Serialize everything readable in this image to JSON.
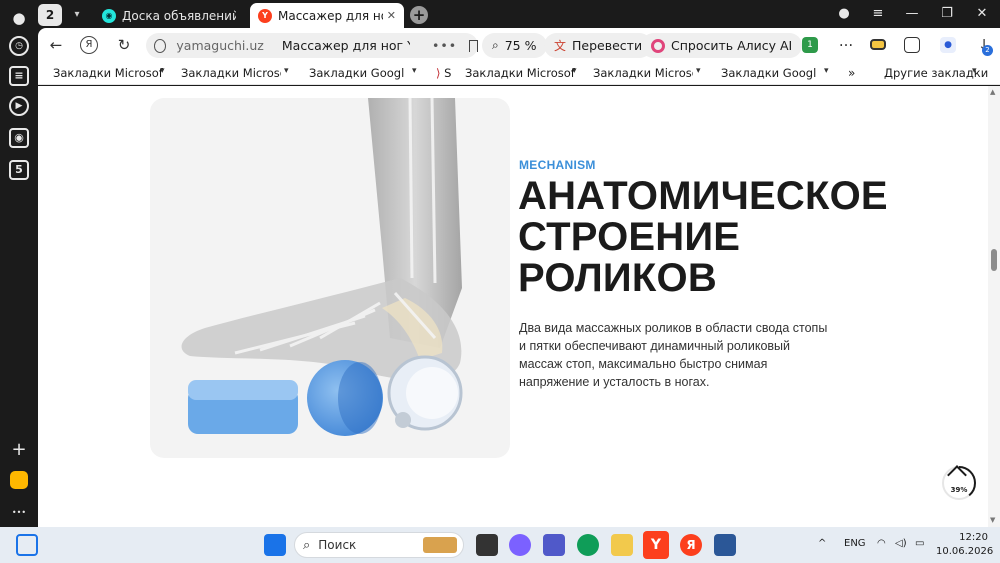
{
  "sidebar": {
    "items": [
      {
        "icon": "user-icon"
      },
      {
        "icon": "history-icon"
      },
      {
        "icon": "collections-icon"
      },
      {
        "icon": "video-icon"
      },
      {
        "icon": "screenshot-icon"
      },
      {
        "icon": "number-5-icon",
        "label": "5"
      },
      {
        "icon": "add-icon",
        "label": "+"
      },
      {
        "icon": "messenger-icon"
      },
      {
        "icon": "more-icon",
        "label": "•••"
      }
    ]
  },
  "tabs": {
    "count_badge": "2",
    "items": [
      {
        "label": "Доска объявлений OLX.uz",
        "favicon": "olx",
        "active": false
      },
      {
        "label": "Массажер для ног Yamaguchi",
        "favicon": "Y",
        "active": true
      }
    ],
    "close_glyph": "✕",
    "new_tab_glyph": "+"
  },
  "window": {
    "profile_glyph": "👤",
    "menu_glyph": "≡",
    "minimize_glyph": "—",
    "restore_glyph": "❐",
    "close_glyph": "✕"
  },
  "toolbar": {
    "back_glyph": "←",
    "ya_glyph": "Я",
    "reload_glyph": "↻",
    "domain": "yamaguchi.uz",
    "page_title": "Массажер для ног Yama...",
    "dots": "•••",
    "zoom": "75 %",
    "translate": "Перевести",
    "ask_alice": "Спросить Алису AI",
    "more_glyph": "...",
    "ext_badge_1": "1",
    "ext_badge_2": "2",
    "download_glyph": "↓"
  },
  "bookmarks": {
    "items": [
      "Закладки Microsoft Edge",
      "Закладки Microsoft Edge",
      "Закладки Google Chrome",
      "S",
      "Закладки Microsoft Edge",
      "Закладки Microsoft Edge",
      "Закладки Google Chrome"
    ],
    "overflow_glyph": "»",
    "other": "Другие закладки"
  },
  "content": {
    "eyebrow": "MECHANISM",
    "heading_line1": "АНАТОМИЧЕСКОЕ",
    "heading_line2": "СТРОЕНИЕ",
    "heading_line3": "РОЛИКОВ",
    "description": "Два вида массажных роликов в области свода стопы и пятки обеспечивают динамичный роликовый массаж стоп, максимально быстро снимая напряжение и усталость в ногах.",
    "scroll_percent": "39%"
  },
  "taskbar": {
    "search_placeholder": "Поиск",
    "lang": "ENG",
    "time": "12:20",
    "date": "10.06.2026",
    "tray_up": "^"
  },
  "colors": {
    "accent_blue": "#3b8fd9",
    "roller_blue": "#5b9be0",
    "yandex_red": "#fc3f1d"
  }
}
